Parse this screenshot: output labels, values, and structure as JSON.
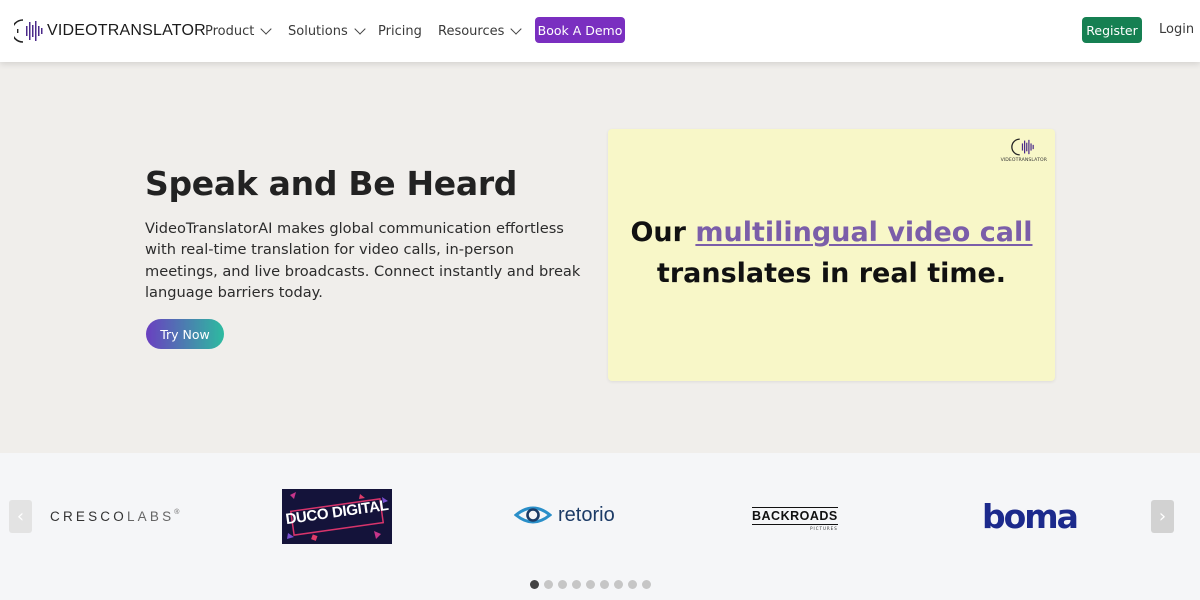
{
  "header": {
    "logo_text": "VIDEOTRANSLATOR",
    "nav": [
      {
        "label": "Product",
        "has_dropdown": true
      },
      {
        "label": "Solutions",
        "has_dropdown": true
      },
      {
        "label": "Pricing",
        "has_dropdown": false
      },
      {
        "label": "Resources",
        "has_dropdown": true
      }
    ],
    "demo_label": "Book A Demo",
    "register_label": "Register",
    "login_label": "Login"
  },
  "hero": {
    "title": "Speak and Be Heard",
    "description": "VideoTranslatorAI makes global communication effortless with real-time translation for video calls, in-person meetings, and live broadcasts. Connect instantly and break language barriers today.",
    "cta_label": "Try Now"
  },
  "video": {
    "logo_text": "VIDEOTRANSLATOR",
    "line1_prefix": "Our",
    "line1_highlight": "multilingual video call",
    "line2": "translates in real time."
  },
  "logos": {
    "cresco_main": "CRESCO",
    "cresco_light": "LABS",
    "cresco_mark": "®",
    "duco_text": "DUCO DIGITAL",
    "retorio_text": "retorio",
    "backroads_main": "BACKROADS",
    "backroads_sub": "PICTURES",
    "boma_text": "boma",
    "arrow_left": "‹",
    "arrow_right": "›",
    "dot_count": 9,
    "active_dot": 0
  },
  "colors": {
    "accent_purple": "#7a2fc0",
    "register_green": "#168052",
    "highlight_purple": "#7b5ea9",
    "video_bg": "#f8f7c8"
  },
  "icons": [
    "soundwave-logo-icon",
    "chevron-down-icon",
    "chevron-left-icon",
    "chevron-right-icon",
    "eye-icon"
  ]
}
